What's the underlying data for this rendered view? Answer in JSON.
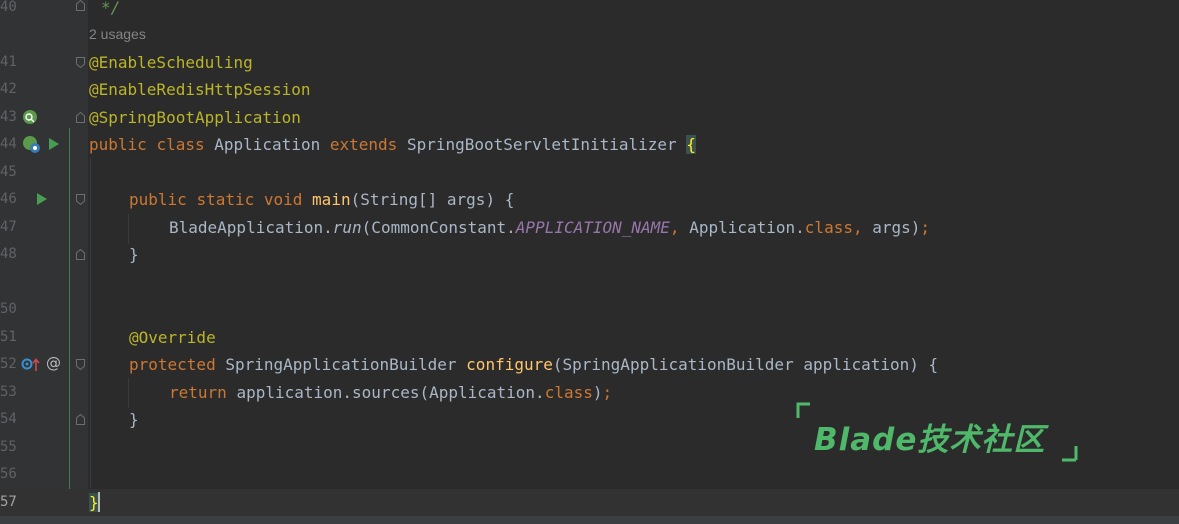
{
  "editor": {
    "line_numbers": [
      "40",
      "41",
      "42",
      "43",
      "44",
      "45",
      "46",
      "47",
      "48",
      "50",
      "51",
      "52",
      "53",
      "54",
      "55",
      "56",
      "57"
    ],
    "usages_hint": "2 usages",
    "lines": {
      "l40": "*/",
      "l41": "@EnableScheduling",
      "l42": "@EnableRedisHttpSession",
      "l43": "@SpringBootApplication",
      "l44_kw1": "public",
      "l44_kw2": "class",
      "l44_name": "Application",
      "l44_kw3": "extends",
      "l44_super": "SpringBootServletInitializer",
      "l44_brace": "{",
      "l46_kw1": "public",
      "l46_kw2": "static",
      "l46_kw3": "void",
      "l46_fn": "main",
      "l46_rest": "(String[] args) {",
      "l47_a": "BladeApplication.",
      "l47_run": "run",
      "l47_b": "(CommonConstant.",
      "l47_const": "APPLICATION_NAME",
      "l47_comma": ",",
      "l47_c": " Application.",
      "l47_class": "class",
      "l47_comma2": ",",
      "l47_d": " args)",
      "l47_semi": ";",
      "l48": "}",
      "l51": "@Override",
      "l52_kw": "protected",
      "l52_type": "SpringApplicationBuilder",
      "l52_fn": "configure",
      "l52_rest": "(SpringApplicationBuilder application) {",
      "l53_kw": "return",
      "l53_a": "application.sources(Application.",
      "l53_class": "class",
      "l53_b": ")",
      "l53_semi": ";",
      "l54": "}",
      "l57": "}"
    },
    "gutter_at_symbol": "@"
  },
  "watermark": {
    "text": "Blade技术社区"
  },
  "colors": {
    "background": "#2b2b2b",
    "keyword": "#cc7832",
    "annotation": "#bbb529",
    "function": "#ffc66d",
    "constant": "#9876aa",
    "watermark": "#4fb86a"
  }
}
